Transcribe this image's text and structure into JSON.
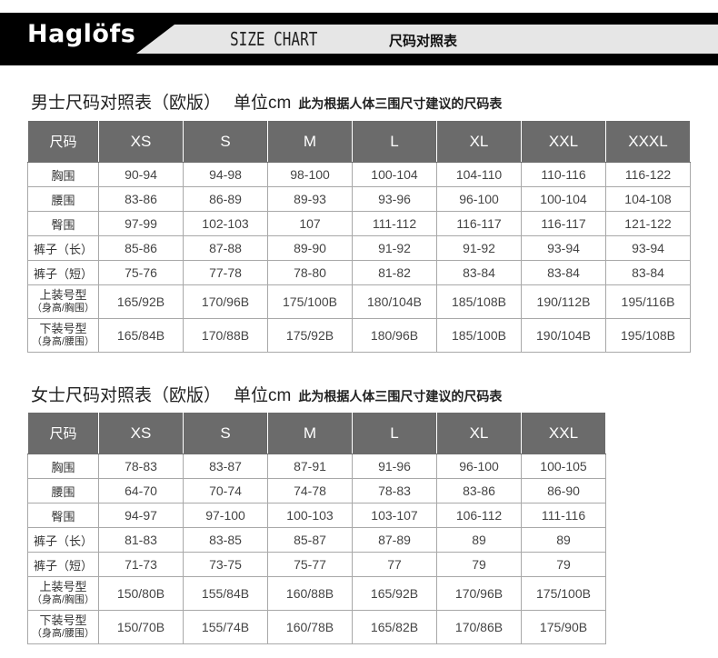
{
  "header": {
    "logo": "Haglöfs",
    "size_chart": "SIZE CHART",
    "cn_title": "尺码对照表"
  },
  "men": {
    "title": "男士尺码对照表（欧版）",
    "unit": "单位cm",
    "note": "此为根据人体三围尺寸建议的尺码表",
    "columns": [
      "尺码",
      "XS",
      "S",
      "M",
      "L",
      "XL",
      "XXL",
      "XXXL"
    ],
    "rows": [
      {
        "label": "胸围",
        "values": [
          "90-94",
          "94-98",
          "98-100",
          "100-104",
          "104-110",
          "110-116",
          "116-122"
        ]
      },
      {
        "label": "腰围",
        "values": [
          "83-86",
          "86-89",
          "89-93",
          "93-96",
          "96-100",
          "100-104",
          "104-108"
        ]
      },
      {
        "label": "臀围",
        "values": [
          "97-99",
          "102-103",
          "107",
          "111-112",
          "116-117",
          "116-117",
          "121-122"
        ]
      },
      {
        "label": "裤子（长）",
        "values": [
          "85-86",
          "87-88",
          "89-90",
          "91-92",
          "91-92",
          "93-94",
          "93-94"
        ]
      },
      {
        "label": "裤子（短）",
        "values": [
          "75-76",
          "77-78",
          "78-80",
          "81-82",
          "83-84",
          "83-84",
          "83-84"
        ]
      },
      {
        "label": "上装号型",
        "sub": "（身高/胸围）",
        "values": [
          "165/92B",
          "170/96B",
          "175/100B",
          "180/104B",
          "185/108B",
          "190/112B",
          "195/116B"
        ]
      },
      {
        "label": "下装号型",
        "sub": "（身高/腰围）",
        "values": [
          "165/84B",
          "170/88B",
          "175/92B",
          "180/96B",
          "185/100B",
          "190/104B",
          "195/108B"
        ]
      }
    ]
  },
  "women": {
    "title": "女士尺码对照表（欧版）",
    "unit": "单位cm",
    "note": "此为根据人体三围尺寸建议的尺码表",
    "columns": [
      "尺码",
      "XS",
      "S",
      "M",
      "L",
      "XL",
      "XXL"
    ],
    "rows": [
      {
        "label": "胸围",
        "values": [
          "78-83",
          "83-87",
          "87-91",
          "91-96",
          "96-100",
          "100-105"
        ]
      },
      {
        "label": "腰围",
        "values": [
          "64-70",
          "70-74",
          "74-78",
          "78-83",
          "83-86",
          "86-90"
        ]
      },
      {
        "label": "臀围",
        "values": [
          "94-97",
          "97-100",
          "100-103",
          "103-107",
          "106-112",
          "111-116"
        ]
      },
      {
        "label": "裤子（长）",
        "values": [
          "81-83",
          "83-85",
          "85-87",
          "87-89",
          "89",
          "89"
        ]
      },
      {
        "label": "裤子（短）",
        "values": [
          "71-73",
          "73-75",
          "75-77",
          "77",
          "79",
          "79"
        ]
      },
      {
        "label": "上装号型",
        "sub": "（身高/胸围）",
        "values": [
          "150/80B",
          "155/84B",
          "160/88B",
          "165/92B",
          "170/96B",
          "175/100B"
        ]
      },
      {
        "label": "下装号型",
        "sub": "（身高/腰围）",
        "values": [
          "150/70B",
          "155/74B",
          "160/78B",
          "165/82B",
          "170/86B",
          "175/90B"
        ]
      }
    ]
  }
}
